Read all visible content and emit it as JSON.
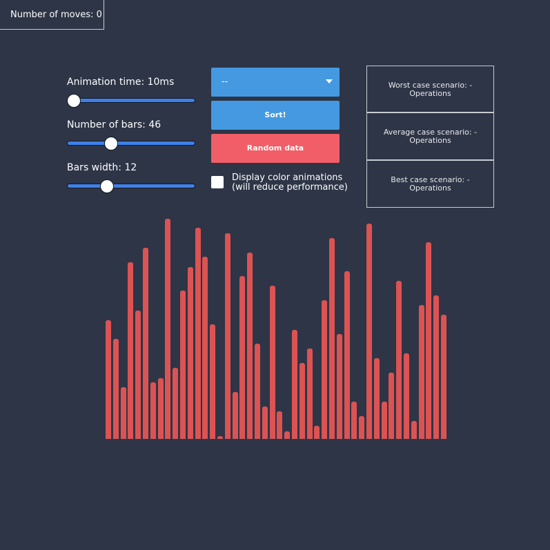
{
  "moves": {
    "label": "Number of moves: 0"
  },
  "sliders": {
    "animation_time": {
      "label": "Animation time: 10ms",
      "value": 10
    },
    "number_of_bars": {
      "label": "Number of bars: 46",
      "value": 46
    },
    "bars_width": {
      "label": "Bars width: 12",
      "value": 12
    }
  },
  "algorithm_select": {
    "value": "--"
  },
  "buttons": {
    "sort": "Sort!",
    "random": "Random data"
  },
  "color_animations": {
    "checked": false,
    "line1": "Display color animations",
    "line2": "(will reduce performance)"
  },
  "scenarios": {
    "worst": {
      "line1": "Worst case scenario: -",
      "line2": "Operations"
    },
    "average": {
      "line1": "Average case scenario: -",
      "line2": "Operations"
    },
    "best": {
      "line1": "Best case scenario: -",
      "line2": "Operations"
    }
  },
  "colors": {
    "background": "#2e3546",
    "bar": "#dc5353",
    "primary_button": "#4499e1",
    "danger_button": "#f25e67",
    "slider_track": "#3f80e6"
  },
  "bars": [
    172,
    145,
    75,
    256,
    186,
    277,
    82,
    88,
    319,
    103,
    215,
    249,
    306,
    264,
    166,
    4,
    298,
    68,
    236,
    270,
    138,
    47,
    222,
    40,
    11,
    158,
    110,
    131,
    19,
    201,
    291,
    152,
    243,
    54,
    33,
    312,
    117,
    54,
    96,
    229,
    124,
    26,
    194,
    285,
    208,
    180
  ]
}
